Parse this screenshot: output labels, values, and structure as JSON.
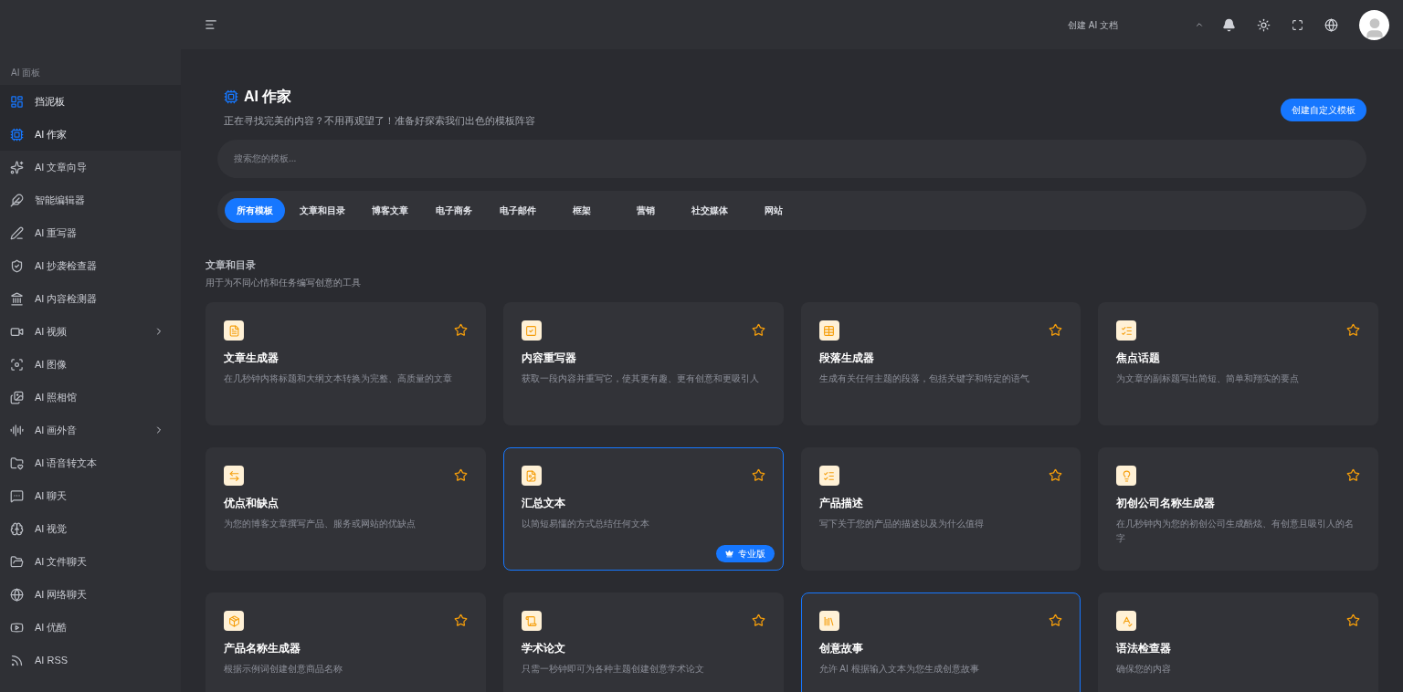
{
  "header": {
    "doc_menu": "创建 AI 文档"
  },
  "sidebar": {
    "section_label": "AI 面板",
    "items": [
      {
        "label": "挡泥板",
        "selected": true,
        "expandable": false
      },
      {
        "label": "AI 作家",
        "selected": true,
        "expandable": false
      },
      {
        "label": "AI 文章向导",
        "selected": false,
        "expandable": false
      },
      {
        "label": "智能编辑器",
        "selected": false,
        "expandable": false
      },
      {
        "label": "AI 重写器",
        "selected": false,
        "expandable": false
      },
      {
        "label": "AI 抄袭检查器",
        "selected": false,
        "expandable": false
      },
      {
        "label": "AI 内容检测器",
        "selected": false,
        "expandable": false
      },
      {
        "label": "AI 视频",
        "selected": false,
        "expandable": true
      },
      {
        "label": "AI 图像",
        "selected": false,
        "expandable": false
      },
      {
        "label": "AI 照相馆",
        "selected": false,
        "expandable": false
      },
      {
        "label": "AI 画外音",
        "selected": false,
        "expandable": true
      },
      {
        "label": "AI 语音转文本",
        "selected": false,
        "expandable": false
      },
      {
        "label": "AI 聊天",
        "selected": false,
        "expandable": false
      },
      {
        "label": "AI 视觉",
        "selected": false,
        "expandable": false
      },
      {
        "label": "AI 文件聊天",
        "selected": false,
        "expandable": false
      },
      {
        "label": "AI 网络聊天",
        "selected": false,
        "expandable": false
      },
      {
        "label": "AI 优酷",
        "selected": false,
        "expandable": false
      },
      {
        "label": "AI RSS",
        "selected": false,
        "expandable": false
      }
    ]
  },
  "page": {
    "title": "AI 作家",
    "subtitle": "正在寻找完美的内容？不用再观望了！准备好探索我们出色的模板阵容",
    "create_button": "创建自定义模板",
    "search": {
      "placeholder": "搜索您的模板..."
    }
  },
  "tabs": [
    {
      "label": "所有模板",
      "selected": true
    },
    {
      "label": "文章和目录",
      "selected": false
    },
    {
      "label": "博客文章",
      "selected": false
    },
    {
      "label": "电子商务",
      "selected": false
    },
    {
      "label": "电子邮件",
      "selected": false
    },
    {
      "label": "框架",
      "selected": false
    },
    {
      "label": "营销",
      "selected": false
    },
    {
      "label": "社交媒体",
      "selected": false
    },
    {
      "label": "网站",
      "selected": false
    }
  ],
  "section": {
    "title": "文章和目录",
    "subtitle": "用于为不同心情和任务编写创意的工具"
  },
  "cards": [
    {
      "title": "文章生成器",
      "description": "在几秒钟内将标题和大纲文本转换为完整、高质量的文章",
      "selected": false
    },
    {
      "title": "内容重写器",
      "description": "获取一段内容并重写它，使其更有趣、更有创意和更吸引人",
      "selected": false
    },
    {
      "title": "段落生成器",
      "description": "生成有关任何主题的段落，包括关键字和特定的语气",
      "selected": false
    },
    {
      "title": "焦点话题",
      "description": "为文章的副标题写出简短、简单和翔实的要点",
      "selected": false
    },
    {
      "title": "优点和缺点",
      "description": "为您的博客文章撰写产品、服务或网站的优缺点",
      "selected": false
    },
    {
      "title": "汇总文本",
      "description": "以简短易懂的方式总结任何文本",
      "selected": true,
      "badge": "专业版"
    },
    {
      "title": "产品描述",
      "description": "写下关于您的产品的描述以及为什么值得",
      "selected": false
    },
    {
      "title": "初创公司名称生成器",
      "description": "在几秒钟内为您的初创公司生成酷炫、有创意且吸引人的名字",
      "selected": false
    },
    {
      "title": "产品名称生成器",
      "description": "根据示例词创建创意商品名称",
      "selected": false
    },
    {
      "title": "学术论文",
      "description": "只需一秒钟即可为各种主题创建创意学术论文",
      "selected": false
    },
    {
      "title": "创意故事",
      "description": "允许 AI 根据输入文本为您生成创意故事",
      "selected": true
    },
    {
      "title": "语法检查器",
      "description": "确保您的内容",
      "selected": false
    }
  ]
}
